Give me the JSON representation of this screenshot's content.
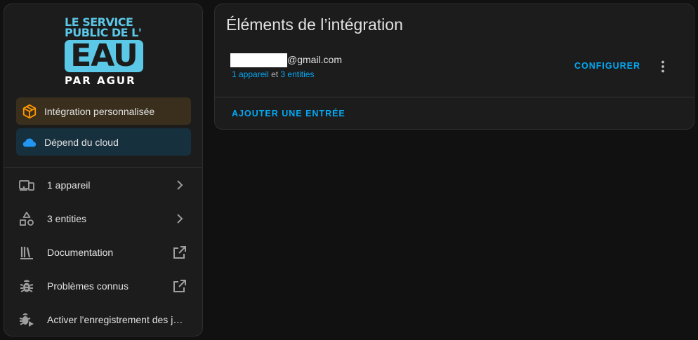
{
  "logo": {
    "line1": "LE SERVICE",
    "line2": "PUBLIC DE L'",
    "big": "EAU",
    "line3": "PAR AGUR"
  },
  "badges": {
    "custom": "Intégration personnalisée",
    "cloud": "Dépend du cloud"
  },
  "menu": {
    "devices": "1 appareil",
    "entities": "3 entities",
    "documentation": "Documentation",
    "issues": "Problèmes connus",
    "debug_logging": "Activer l'enregistrement des journaux de débogage"
  },
  "main": {
    "title": "Éléments de l’intégration",
    "entry": {
      "email_suffix": "@gmail.com",
      "devices_link": "1 appareil",
      "separator": "et",
      "entities_link": "3 entities"
    },
    "configure_label": "CONFIGURER",
    "add_entry_label": "AJOUTER UNE ENTRÉE"
  },
  "colors": {
    "accent": "#03a9f4",
    "logo_blue": "#5bc8e8",
    "custom_badge": "#3a2f1d",
    "cloud_badge": "#17303e"
  }
}
